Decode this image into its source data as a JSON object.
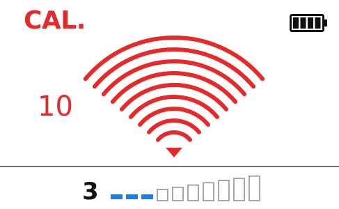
{
  "mode_label": "CAL.",
  "battery": {
    "level": 1.0,
    "icon": "battery-full-icon",
    "color": "#111111"
  },
  "level_value": "10",
  "signal": {
    "icon": "wireless-signal-icon",
    "arcs": 9,
    "color": "#e32b2b"
  },
  "channel": "3",
  "meter": {
    "segments": 10,
    "filled": 3,
    "filled_color": "#1a7ee0",
    "empty_color": "#8a8a8a"
  },
  "colors": {
    "accent": "#e32b2b",
    "divider": "#707070"
  }
}
